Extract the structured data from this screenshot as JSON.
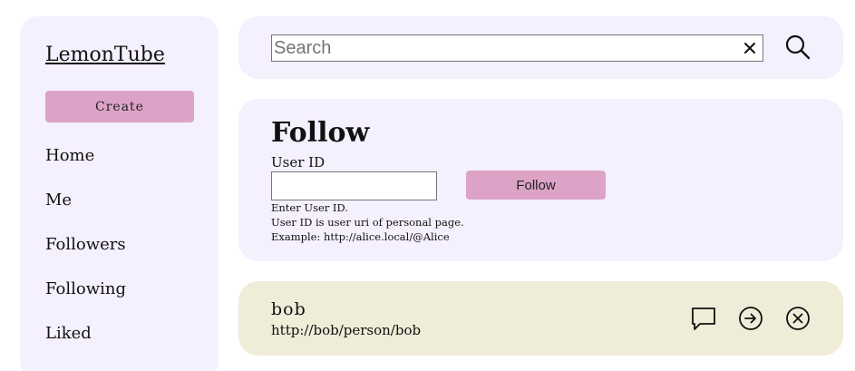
{
  "app": {
    "title": "LemonTube"
  },
  "sidebar": {
    "create_label": "Create",
    "items": [
      {
        "label": "Home"
      },
      {
        "label": "Me"
      },
      {
        "label": "Followers"
      },
      {
        "label": "Following"
      },
      {
        "label": "Liked"
      }
    ]
  },
  "search": {
    "placeholder": "Search",
    "value": "",
    "clear_icon": "close-icon",
    "submit_icon": "search-icon"
  },
  "follow": {
    "title": "Follow",
    "field_label": "User ID",
    "field_value": "",
    "button_label": "Follow",
    "help_lines": [
      "Enter User ID.",
      "User ID is user uri of personal page.",
      "Example: http://alice.local/@Alice"
    ]
  },
  "user_card": {
    "name": "bob",
    "uri": "http://bob/person/bob",
    "actions": [
      "message-icon",
      "arrow-right-circle-icon",
      "close-circle-icon"
    ]
  },
  "colors": {
    "panel": "#f5f0fe",
    "accent": "#dca3c7",
    "user_card": "#efecd8"
  }
}
